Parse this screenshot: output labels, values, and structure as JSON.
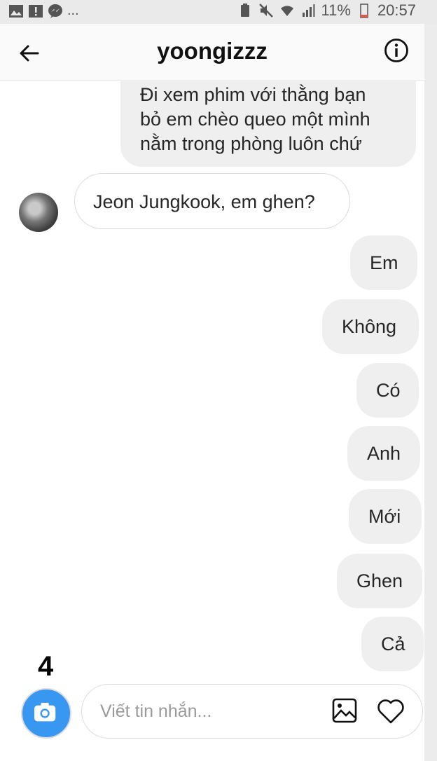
{
  "status_bar": {
    "left_icons": [
      "image-icon",
      "alert-icon",
      "messenger-icon"
    ],
    "left_more": "...",
    "battery_percent": "11%",
    "time": "20:57"
  },
  "header": {
    "title": "yoongizzz",
    "back_icon": "arrow-left-icon",
    "info_icon": "info-icon"
  },
  "messages": [
    {
      "from": "me",
      "lines": [
        "Đi xem phim với thằng bạn",
        "bỏ em chèo queo một mình",
        "nằm trong phòng luôn chứ"
      ]
    },
    {
      "from": "them",
      "text": "Jeon Jungkook, em ghen?"
    },
    {
      "from": "me",
      "text": "Em"
    },
    {
      "from": "me",
      "text": "Không"
    },
    {
      "from": "me",
      "text": "Có"
    },
    {
      "from": "me",
      "text": "Anh"
    },
    {
      "from": "me",
      "text": "Mới"
    },
    {
      "from": "me",
      "text": "Ghen"
    },
    {
      "from": "me",
      "text": "Cả"
    }
  ],
  "overlay_number": "4",
  "composer": {
    "placeholder": "Viết tin nhắn...",
    "camera_icon": "camera-icon",
    "gallery_icon": "image-icon",
    "like_icon": "heart-icon"
  }
}
